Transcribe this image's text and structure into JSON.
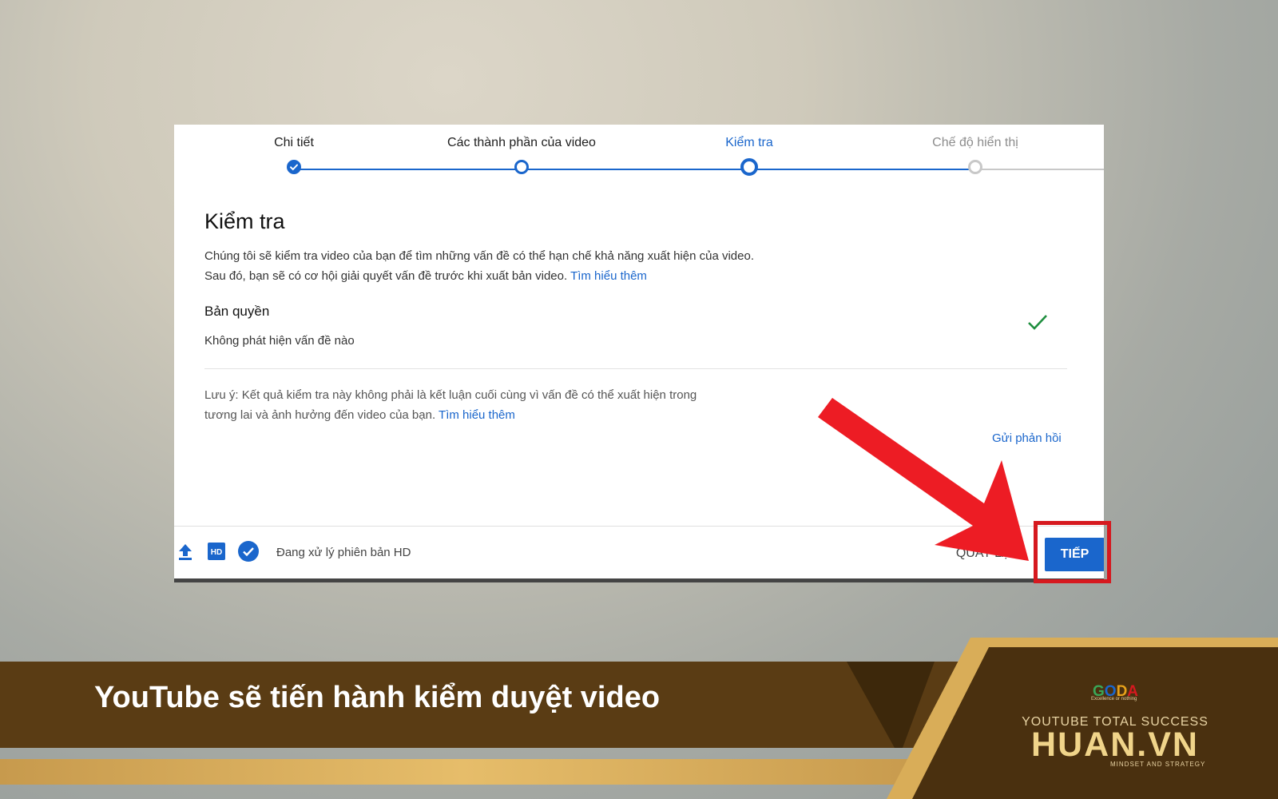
{
  "stepper": {
    "steps": [
      {
        "label": "Chi tiết",
        "state": "done"
      },
      {
        "label": "Các thành phần của video",
        "state": "done"
      },
      {
        "label": "Kiểm tra",
        "state": "active"
      },
      {
        "label": "Chế độ hiển thị",
        "state": "pending"
      }
    ]
  },
  "checks": {
    "title": "Kiểm tra",
    "description": "Chúng tôi sẽ kiểm tra video của bạn để tìm những vấn đề có thể hạn chế khả năng xuất hiện của video. Sau đó, bạn sẽ có cơ hội giải quyết vấn đề trước khi xuất bản video.",
    "learn_more": "Tìm hiểu thêm",
    "copyright_title": "Bản quyền",
    "copyright_status": "Không phát hiện vấn đề nào",
    "note": "Lưu ý: Kết quả kiểm tra này không phải là kết luận cuối cùng vì vấn đề có thể xuất hiện trong tương lai và ảnh hưởng đến video của bạn.",
    "note_learn_more": "Tìm hiểu thêm",
    "feedback": "Gửi phản hồi"
  },
  "footer": {
    "status": "Đang xử lý phiên bản HD",
    "back_label": "QUAY LẠI",
    "next_label": "TIẾP"
  },
  "banner": {
    "title": "YouTube sẽ tiến hành kiểm duyệt video",
    "logo_small": "GODA",
    "logo_small_tagline": "Excellence or nothing",
    "brand_tagline": "YOUTUBE TOTAL SUCCESS",
    "brand_name": "HUAN.VN",
    "brand_sub": "MINDSET AND STRATEGY"
  },
  "colors": {
    "accent": "#1a66cc",
    "success": "#1e8e3e",
    "highlight": "#d6191f",
    "banner_bg": "#5a3c14",
    "gold": "#e6bd6a"
  }
}
